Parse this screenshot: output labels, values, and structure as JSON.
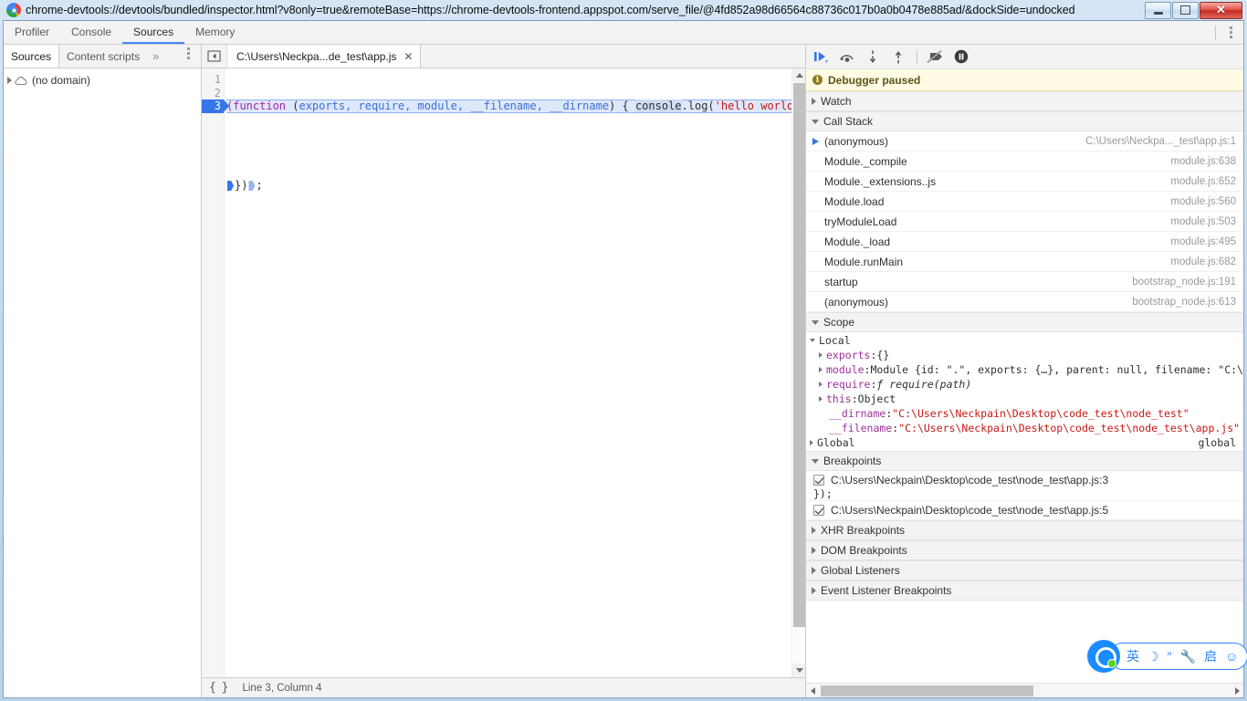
{
  "window": {
    "title": "chrome-devtools://devtools/bundled/inspector.html?v8only=true&remoteBase=https://chrome-devtools-frontend.appspot.com/serve_file/@4fd852a98d66564c88736c017b0a0b0478e885ad/&dockSide=undocked",
    "favicon": "chrome-logo-icon",
    "buttons": {
      "minimize": "minimize-icon",
      "restore": "restore-icon",
      "close": "✕"
    }
  },
  "main_tabs": [
    {
      "label": "Profiler",
      "selected": false
    },
    {
      "label": "Console",
      "selected": false
    },
    {
      "label": "Sources",
      "selected": true
    },
    {
      "label": "Memory",
      "selected": false
    }
  ],
  "main_tabbar_right": {
    "menu": "more-options-icon"
  },
  "navigator": {
    "tabs": [
      {
        "label": "Sources",
        "selected": true
      },
      {
        "label": "Content scripts",
        "selected": false
      }
    ],
    "more_label": "»",
    "menu_icon": "more-options-icon",
    "tree": [
      {
        "label": "(no domain)",
        "icon": "cloud-icon",
        "expanded": false
      }
    ]
  },
  "editor": {
    "toggle_navigator_icon": "show-navigator-icon",
    "tabs": [
      {
        "label": "C:\\Users\\Neckpa...de_test\\app.js",
        "close": "✕",
        "selected": true
      }
    ],
    "line_numbers": [
      "1",
      "2",
      "3"
    ],
    "breakpoint_line": 3,
    "code": {
      "line1": {
        "p1": "(function",
        "p2": " (",
        "p3": "exports, require, module, __filename, __dirname",
        "p4": ") { ",
        "p5": "console",
        "p6": ".log(",
        "p7": "'hello world'",
        "p8": ")"
      },
      "line2": "",
      "line3": {
        "p1": "})",
        "p2": ";"
      }
    },
    "status": {
      "pretty_print": "{ }",
      "position": "Line 3, Column 4"
    }
  },
  "debugger": {
    "toolbar": [
      {
        "name": "resume-script-execution-icon"
      },
      {
        "name": "step-over-next-function-call-icon"
      },
      {
        "name": "step-into-next-function-call-icon"
      },
      {
        "name": "step-out-of-current-function-icon"
      },
      {
        "name": "deactivate-breakpoints-icon"
      },
      {
        "name": "pause-on-exceptions-icon"
      }
    ],
    "paused_banner": {
      "icon": "i",
      "text": "Debugger paused"
    },
    "sections": {
      "watch": {
        "label": "Watch",
        "expanded": false
      },
      "call_stack": {
        "label": "Call Stack",
        "expanded": true
      },
      "scope": {
        "label": "Scope",
        "expanded": true
      },
      "breakpoints": {
        "label": "Breakpoints",
        "expanded": true
      },
      "xhr_breakpoints": {
        "label": "XHR Breakpoints",
        "expanded": false
      },
      "dom_breakpoints": {
        "label": "DOM Breakpoints",
        "expanded": false
      },
      "global_listeners": {
        "label": "Global Listeners",
        "expanded": false
      },
      "event_listener_breakpoints": {
        "label": "Event Listener Breakpoints",
        "expanded": false
      }
    },
    "call_stack": [
      {
        "name": "(anonymous)",
        "location": "C:\\Users\\Neckpa..._test\\app.js:1",
        "active": true
      },
      {
        "name": "Module._compile",
        "location": "module.js:638",
        "active": false
      },
      {
        "name": "Module._extensions..js",
        "location": "module.js:652",
        "active": false
      },
      {
        "name": "Module.load",
        "location": "module.js:560",
        "active": false
      },
      {
        "name": "tryModuleLoad",
        "location": "module.js:503",
        "active": false
      },
      {
        "name": "Module._load",
        "location": "module.js:495",
        "active": false
      },
      {
        "name": "Module.runMain",
        "location": "module.js:682",
        "active": false
      },
      {
        "name": "startup",
        "location": "bootstrap_node.js:191",
        "active": false
      },
      {
        "name": "(anonymous)",
        "location": "bootstrap_node.js:613",
        "active": false
      }
    ],
    "scope": {
      "local_label": "Local",
      "rows": [
        {
          "prop": "exports",
          "sep": ": ",
          "value": "{}",
          "kind": "plain",
          "expandable": true
        },
        {
          "prop": "module",
          "sep": ": ",
          "value": "Module {id: \".\", exports: {…}, parent: null, filename: \"C:\\Us",
          "kind": "mixed",
          "expandable": true
        },
        {
          "prop": "require",
          "sep": ": ",
          "value": "ƒ require(path)",
          "kind": "function",
          "expandable": true
        },
        {
          "prop": "this",
          "sep": ": ",
          "value": "Object",
          "kind": "plain",
          "expandable": true
        },
        {
          "prop": "__dirname",
          "sep": ": ",
          "value": "\"C:\\Users\\Neckpain\\Desktop\\code_test\\node_test\"",
          "kind": "string",
          "expandable": false
        },
        {
          "prop": "__filename",
          "sep": ": ",
          "value": "\"C:\\Users\\Neckpain\\Desktop\\code_test\\node_test\\app.js\"",
          "kind": "string",
          "expandable": false
        }
      ],
      "global_label": "Global",
      "global_value": "global"
    },
    "breakpoints": [
      {
        "checked": true,
        "location": "C:\\Users\\Neckpain\\Desktop\\code_test\\node_test\\app.js:3",
        "snippet": "});"
      },
      {
        "checked": true,
        "location": "C:\\Users\\Neckpain\\Desktop\\code_test\\node_test\\app.js:5",
        "snippet": ""
      }
    ]
  },
  "ime": {
    "logo": "qq-pinyin-logo-icon",
    "items": [
      {
        "glyph": "英",
        "name": "input-mode-english"
      },
      {
        "glyph": "☽",
        "name": "moon-icon"
      },
      {
        "glyph": "″",
        "name": "punctuation-icon"
      },
      {
        "glyph": "🔧",
        "name": "wrench-icon"
      },
      {
        "glyph": "启",
        "name": "toolbox-icon"
      },
      {
        "glyph": "☺",
        "name": "emoji-icon"
      }
    ]
  },
  "colors": {
    "accent_blue": "#3676e8",
    "paused_bg": "#fffbe5",
    "paused_text": "#5c5519",
    "string_red": "#c41a16",
    "keyword_purple": "#a626a4",
    "param_blue": "#3a6fd8",
    "property_magenta": "#a0329b"
  }
}
